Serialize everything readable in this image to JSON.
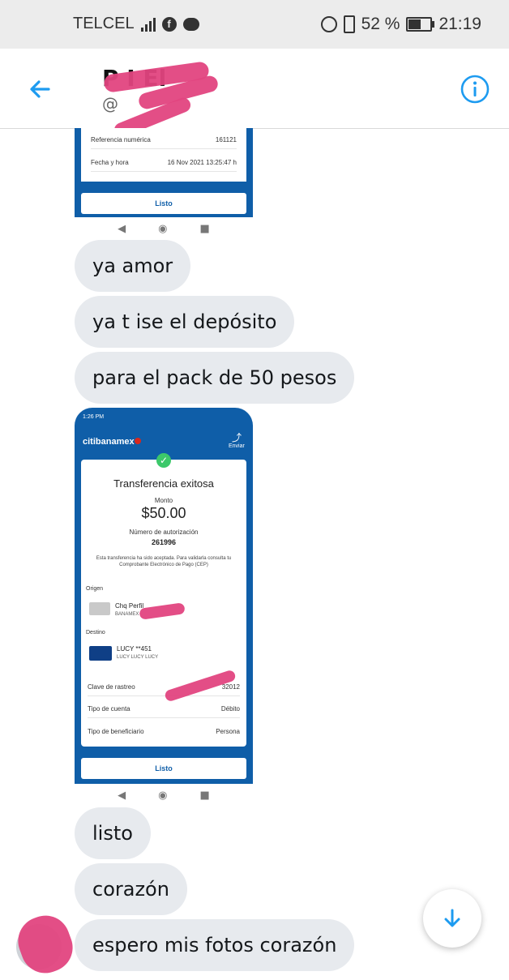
{
  "status": {
    "carrier": "TELCEL",
    "battery": "52 %",
    "battery_level": 0.52,
    "time": "21:19"
  },
  "header": {
    "name": "P     I   El",
    "handle": "@"
  },
  "receipt1": {
    "rows": [
      {
        "label": "Referencia numérica",
        "value": "161121"
      },
      {
        "label": "Fecha y hora",
        "value": "16 Nov 2021 13:25:47 h"
      }
    ],
    "button": "Listo"
  },
  "messages": {
    "m1": "ya amor",
    "m2": "ya t ise el depósito",
    "m3": "para el pack de 50 pesos",
    "m4": "listo",
    "m5": "corazón",
    "m6": "espero mis fotos corazón"
  },
  "receipt2": {
    "status_time": "1:26 PM",
    "bank_logo": "citibanamex",
    "share_label": "Enviar",
    "title": "Transferencia exitosa",
    "amount_label": "Monto",
    "amount": "$50.00",
    "auth_label": "Número de autorización",
    "auth_number": "261996",
    "note": "Esta transferencia ha sido aceptada. Para validarla consulta tu Comprobante Electrónico de Pago (CEP)",
    "origin_label": "Origen",
    "origin_account": "Chq Perfil",
    "origin_bank": "BANAMEX",
    "dest_label": "Destino",
    "dest_name": "LUCY **451",
    "dest_sub": "LUCY LUCY LUCY",
    "rows": [
      {
        "label": "Clave de rastreo",
        "value": "32012"
      },
      {
        "label": "Tipo de cuenta",
        "value": "Débito"
      },
      {
        "label": "Tipo de beneficiario",
        "value": "Persona"
      }
    ],
    "button": "Listo"
  },
  "icons": {
    "back": "back-arrow-icon",
    "info": "info-icon",
    "scroll": "arrow-down-icon"
  },
  "colors": {
    "accent": "#1d9bf0",
    "bubble": "#e7eaee",
    "bank_blue": "#0f5ea8",
    "redaction": "#e2457f"
  }
}
